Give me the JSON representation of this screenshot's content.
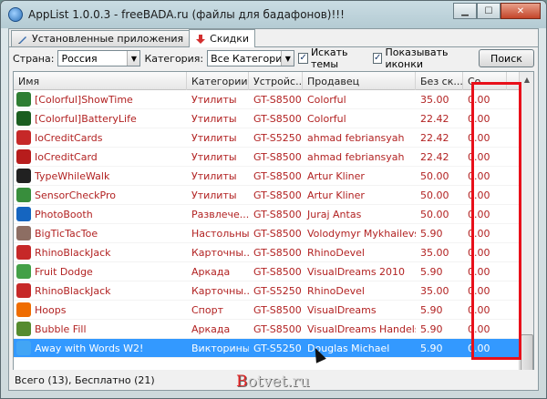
{
  "window": {
    "title": "AppList 1.0.0.3 - freeBADA.ru (файлы для бадафонов)!!!"
  },
  "tabs": [
    {
      "label": "Установленные приложения",
      "icon": "pen-icon"
    },
    {
      "label": "Скидки",
      "icon": "down-arrow-icon"
    }
  ],
  "filters": {
    "country_label": "Страна:",
    "country_value": "Россия",
    "category_label": "Категория:",
    "category_value": "Все Категории",
    "themes_label": "Искать темы",
    "themes_checked": true,
    "icons_label": "Показывать иконки",
    "icons_checked": true,
    "search_button": "Поиск"
  },
  "table": {
    "columns": [
      "Имя",
      "Категории",
      "Устройс...",
      "Продавец",
      "Без ск...",
      "Со ..."
    ],
    "rows": [
      {
        "name": "[Colorful]ShowTime",
        "category": "Утилиты",
        "device": "GT-S8500",
        "seller": "Colorful",
        "price": "35.00",
        "sale": "0.00",
        "icon_color": "#2e7d32"
      },
      {
        "name": "[Colorful]BatteryLife",
        "category": "Утилиты",
        "device": "GT-S8500",
        "seller": "Colorful",
        "price": "22.42",
        "sale": "0.00",
        "icon_color": "#1b5e20"
      },
      {
        "name": "IoCreditCards",
        "category": "Утилиты",
        "device": "GT-S5250",
        "seller": "ahmad febriansyah",
        "price": "22.42",
        "sale": "0.00",
        "icon_color": "#c62828"
      },
      {
        "name": "IoCreditCard",
        "category": "Утилиты",
        "device": "GT-S8500",
        "seller": "ahmad febriansyah",
        "price": "22.42",
        "sale": "0.00",
        "icon_color": "#b71c1c"
      },
      {
        "name": "TypeWhileWalk",
        "category": "Утилиты",
        "device": "GT-S8500",
        "seller": "Artur Kliner",
        "price": "50.00",
        "sale": "0.00",
        "icon_color": "#212121"
      },
      {
        "name": "SensorCheckPro",
        "category": "Утилиты",
        "device": "GT-S8500",
        "seller": "Artur Kliner",
        "price": "50.00",
        "sale": "0.00",
        "icon_color": "#388e3c"
      },
      {
        "name": "PhotoBooth",
        "category": "Развлече...",
        "device": "GT-S8500",
        "seller": "Juraj Antas",
        "price": "50.00",
        "sale": "0.00",
        "icon_color": "#1565c0"
      },
      {
        "name": "BigTicTacToe",
        "category": "Настольные",
        "device": "GT-S8500",
        "seller": "Volodymyr Mykhailevskyi",
        "price": "5.90",
        "sale": "0.00",
        "icon_color": "#8d6e63"
      },
      {
        "name": "RhinoBlackJack",
        "category": "Карточны...",
        "device": "GT-S8500",
        "seller": "RhinoDevel",
        "price": "35.00",
        "sale": "0.00",
        "icon_color": "#c62828"
      },
      {
        "name": "Fruit Dodge",
        "category": "Аркада",
        "device": "GT-S8500",
        "seller": "VisualDreams 2010",
        "price": "5.90",
        "sale": "0.00",
        "icon_color": "#43a047"
      },
      {
        "name": "RhinoBlackJack",
        "category": "Карточны...",
        "device": "GT-S5250",
        "seller": "RhinoDevel",
        "price": "35.00",
        "sale": "0.00",
        "icon_color": "#c62828"
      },
      {
        "name": "Hoops",
        "category": "Спорт",
        "device": "GT-S8500",
        "seller": "VisualDreams",
        "price": "5.90",
        "sale": "0.00",
        "icon_color": "#ef6c00"
      },
      {
        "name": "Bubble Fill",
        "category": "Аркада",
        "device": "GT-S8500",
        "seller": "VisualDreams Handelsb...",
        "price": "5.90",
        "sale": "0.00",
        "icon_color": "#558b2f"
      },
      {
        "name": "Away with Words W2!",
        "category": "Викторины",
        "device": "GT-S5250",
        "seller": "Douglas Michael",
        "price": "5.90",
        "sale": "0.00",
        "icon_color": "#42a5f5",
        "selected": true
      }
    ]
  },
  "status": {
    "text": "Всего (13), Бесплатно (21)"
  },
  "watermark": {
    "first_letter": "B",
    "rest": "otvet.ru"
  },
  "colors": {
    "row_text": "#b22222",
    "selection": "#3399ff",
    "highlight_box": "#e8101a"
  }
}
